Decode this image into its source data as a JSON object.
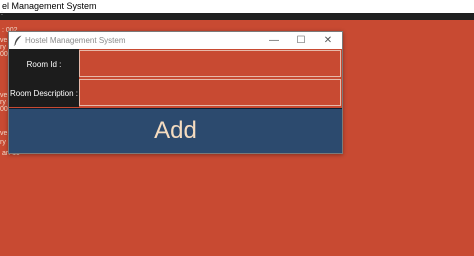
{
  "background_window": {
    "title": "el Management System",
    "menu_fragment": ":"
  },
  "background_fragments": [
    ": 002",
    "ve",
    "ry",
    "00",
    "ve",
    "ry",
    "00",
    "ve",
    "ry",
    "ar: 19"
  ],
  "dialog": {
    "title": "Hostel Management System",
    "controls": {
      "minimize": "—",
      "maximize": "☐",
      "close": "✕"
    },
    "room_id_label": "Room Id :",
    "room_id_value": "",
    "room_description_label": "Room Description :",
    "room_description_value": "",
    "add_button_label": "Add"
  },
  "colors": {
    "background": "#c84a32",
    "label_panel": "#1c1c1c",
    "add_button": "#2c4a6e",
    "add_button_text": "#f5dcc0"
  }
}
